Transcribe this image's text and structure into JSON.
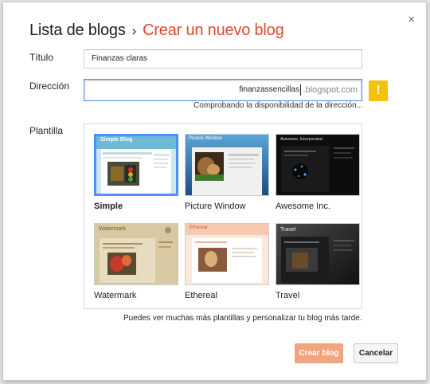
{
  "header": {
    "breadcrumb_root": "Lista de blogs",
    "breadcrumb_separator": "›",
    "breadcrumb_current": "Crear un nuevo blog"
  },
  "form": {
    "title_label": "Título",
    "title_value": "Finanzas claras",
    "address_label": "Dirección",
    "address_value": "finanzassencillas",
    "address_suffix": ".blogspot.com",
    "warning_icon": "!",
    "address_status": "Comprobando la disponibilidad de la dirección...",
    "template_label": "Plantilla"
  },
  "templates": [
    {
      "name": "Simple",
      "selected": true,
      "thumb_title": "Simple Blog"
    },
    {
      "name": "Picture Window",
      "selected": false,
      "thumb_title": "Picture Window"
    },
    {
      "name": "Awesome Inc.",
      "selected": false,
      "thumb_title": "Awesome, Incorporated"
    },
    {
      "name": "Watermark",
      "selected": false,
      "thumb_title": "Watermark"
    },
    {
      "name": "Ethereal",
      "selected": false,
      "thumb_title": "Ethereal"
    },
    {
      "name": "Travel",
      "selected": false,
      "thumb_title": "Travel"
    }
  ],
  "templates_help": "Puedes ver muchas más plantillas y personalizar tu blog más tarde.",
  "buttons": {
    "create": "Crear blog",
    "cancel": "Cancelar"
  },
  "close_icon": "×",
  "colors": {
    "accent_orange": "#dd4b2b",
    "focus_blue": "#4d90fe",
    "warning_yellow": "#f4c20d",
    "create_button": "#f2a47f"
  }
}
